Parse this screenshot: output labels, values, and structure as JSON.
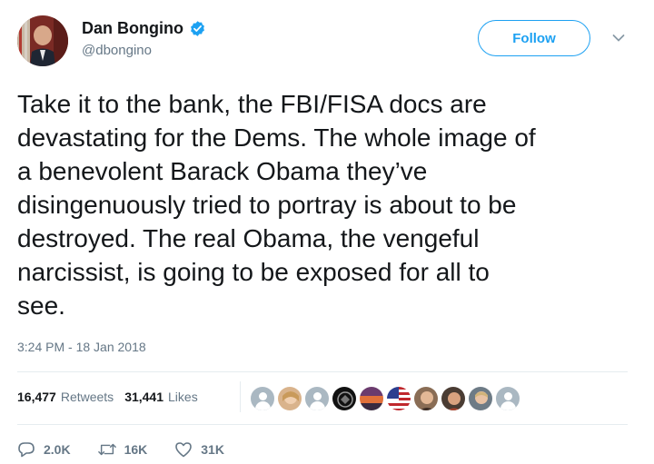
{
  "author": {
    "name": "Dan Bongino",
    "handle": "@dbongino",
    "verified": true,
    "avatar_icon": "user-photo-avatar"
  },
  "follow_button": {
    "label": "Follow"
  },
  "tweet": {
    "text": "Take it to the bank, the FBI/FISA docs are\ndevastating for the Dems. The whole image of\na benevolent Barack Obama they’ve\ndisingenuously tried to portray is about to be\ndestroyed. The real Obama, the vengeful\nnarcissist, is going to be exposed for all to\nsee.",
    "timestamp": "3:24 PM - 18 Jan 2018"
  },
  "stats": {
    "retweets_count": "16,477",
    "retweets_label": "Retweets",
    "likes_count": "31,441",
    "likes_label": "Likes"
  },
  "actions": {
    "replies": "2.0K",
    "retweets": "16K",
    "likes": "31K"
  },
  "colors": {
    "accent": "#1da1f2",
    "text": "#14171a",
    "muted": "#657786",
    "divider": "#e6ecf0"
  }
}
